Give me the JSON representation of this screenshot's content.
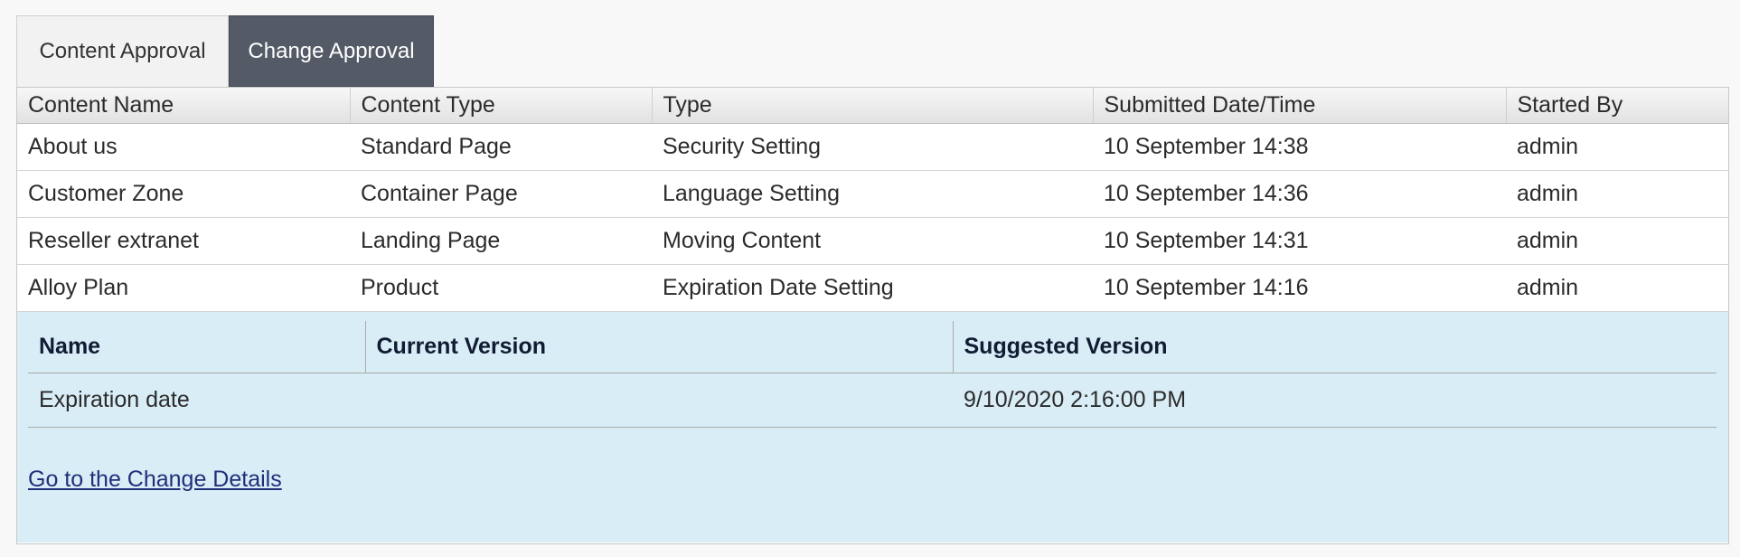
{
  "tabs": [
    {
      "label": "Content Approval",
      "active": false
    },
    {
      "label": "Change Approval",
      "active": true
    }
  ],
  "table": {
    "headers": [
      "Content Name",
      "Content Type",
      "Type",
      "Submitted Date/Time",
      "Started By"
    ],
    "rows": [
      [
        "About us",
        "Standard Page",
        "Security Setting",
        "10 September 14:38",
        "admin"
      ],
      [
        "Customer Zone",
        "Container Page",
        "Language Setting",
        "10 September 14:36",
        "admin"
      ],
      [
        "Reseller extranet",
        "Landing Page",
        "Moving Content",
        "10 September 14:31",
        "admin"
      ],
      [
        "Alloy Plan",
        "Product",
        "Expiration Date Setting",
        "10 September 14:16",
        "admin"
      ]
    ]
  },
  "detail": {
    "headers": [
      "Name",
      "Current Version",
      "Suggested Version"
    ],
    "rows": [
      [
        "Expiration date",
        "",
        "9/10/2020 2:16:00 PM"
      ]
    ],
    "link_label": "Go to the Change Details"
  },
  "colors": {
    "active_tab_bg": "#545b66",
    "detail_bg": "#d9edf6",
    "link": "#1f2f7a"
  }
}
